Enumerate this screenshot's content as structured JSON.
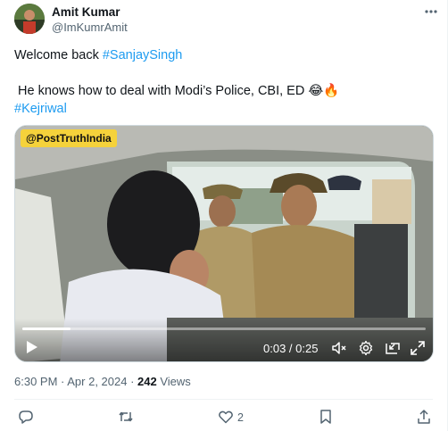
{
  "author": {
    "name": "Amit Kumar",
    "handle": "@ImKumrAmit"
  },
  "tweet": {
    "line1_prefix": "Welcome back ",
    "line1_hashtag": "#SanjaySingh",
    "line2": " He knows how to deal with Modi’s Police, CBI, ED 😂🔥",
    "line3_hashtag": "#Kejriwal"
  },
  "video": {
    "watermark": "@PostTruthIndia",
    "current_time": "0:03",
    "duration": "0:25",
    "time_display": "0:03 / 0:25",
    "progress_fraction": 0.12
  },
  "meta": {
    "timestamp": "6:30 PM · Apr 2, 2024 · ",
    "views_count": "242",
    "views_label": " Views"
  },
  "actions": {
    "reply_count": "",
    "retweet_count": "",
    "like_count": "2",
    "bookmark_count": ""
  },
  "icons": {
    "more": "more-options-icon",
    "play": "play-icon",
    "mute": "volume-mute-icon",
    "settings": "settings-gear-icon",
    "pip": "picture-in-picture-icon",
    "fullscreen": "fullscreen-icon",
    "reply": "reply-icon",
    "retweet": "retweet-icon",
    "like": "heart-icon",
    "bookmark": "bookmark-icon",
    "share": "share-icon"
  },
  "colors": {
    "accent": "#1d9bf0",
    "text_primary": "#0f1419",
    "text_secondary": "#536471",
    "watermark_bg": "#f5d23b"
  }
}
